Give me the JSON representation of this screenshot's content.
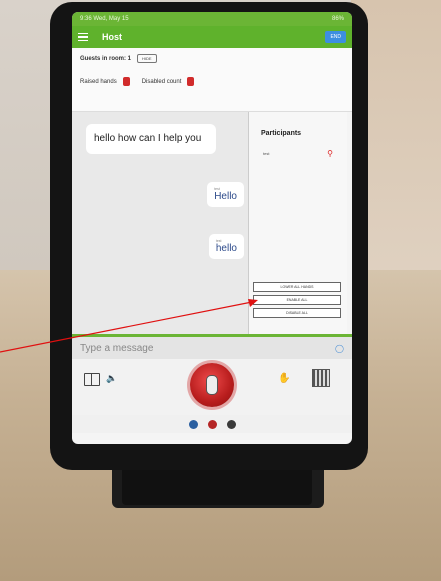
{
  "status": {
    "time": "9:36",
    "date": "Wed, May 15",
    "battery": "86%"
  },
  "appbar": {
    "title": "Host",
    "end_label": "END"
  },
  "info": {
    "guests_label": "Guests in room: 1",
    "hide_label": "HIDE",
    "raised_hands_label": "Raised hands",
    "disabled_count_label": "Disabled count"
  },
  "chat": {
    "messages": [
      {
        "side": "left",
        "text": "hello how can I help you"
      },
      {
        "side": "right",
        "sender": "test",
        "text": "Hello"
      },
      {
        "side": "right",
        "sender": "test",
        "text": "hello"
      }
    ]
  },
  "participants": {
    "title": "Participants",
    "list": [
      {
        "name": "test"
      }
    ],
    "buttons": [
      "LOWER ALL HANDS",
      "ENABLE ALL",
      "DISABLE ALL"
    ]
  },
  "composer": {
    "placeholder": "Type a message"
  },
  "colors": {
    "brand_green": "#5fb22c",
    "end_blue": "#3d8fe0",
    "mic_red": "#c62222",
    "annotation_red": "#e01010"
  },
  "icons": [
    "menu-icon",
    "book-icon",
    "speaker-icon",
    "mic-icon",
    "raise-hand-icon",
    "qr-code-icon",
    "attach-icon"
  ]
}
